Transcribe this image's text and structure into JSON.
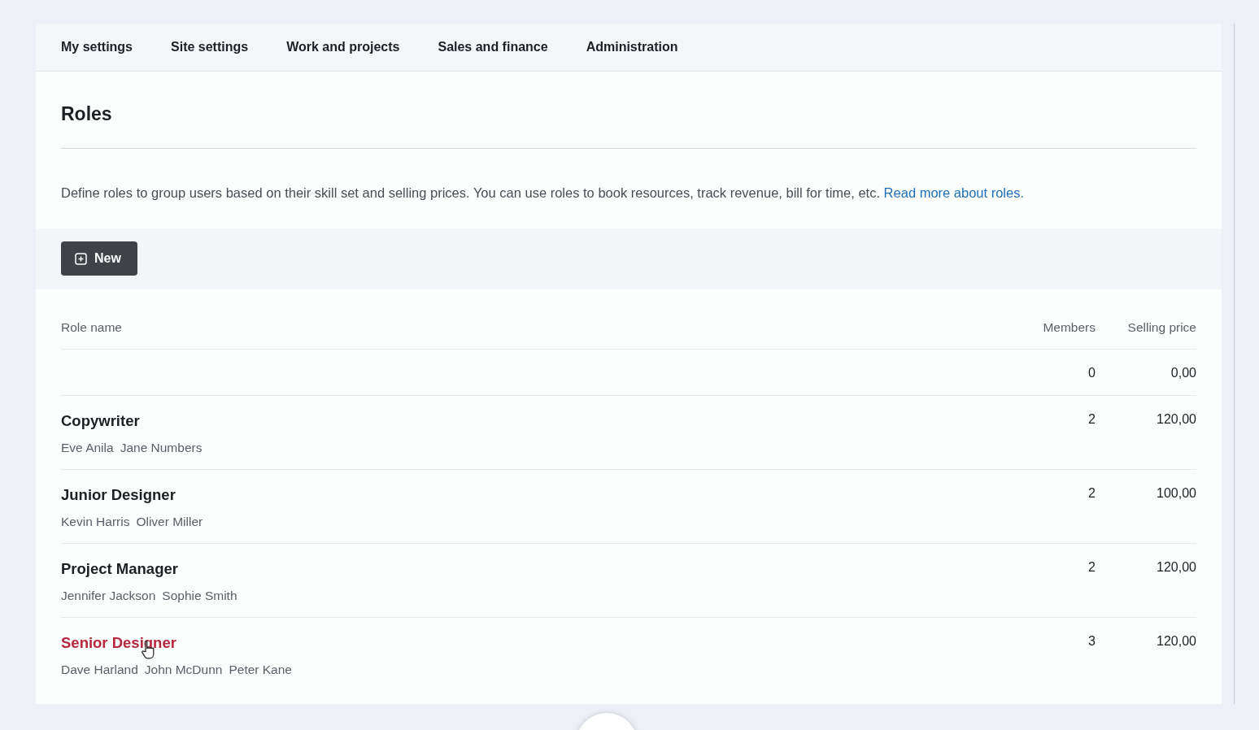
{
  "tabs": [
    {
      "label": "My settings",
      "selected": false
    },
    {
      "label": "Site settings",
      "selected": false
    },
    {
      "label": "Work and projects",
      "selected": false
    },
    {
      "label": "Sales and finance",
      "selected": false
    },
    {
      "label": "Administration",
      "selected": false
    }
  ],
  "page_title": "Roles",
  "description": {
    "text": "Define roles to group users based on their skill set and selling prices. You can use roles to book resources, track revenue, bill for time, etc.",
    "link": "Read more about roles."
  },
  "new_button": "New",
  "table": {
    "columns": [
      "Role name",
      "Members",
      "Selling price"
    ],
    "rows": [
      {
        "members_count": "0",
        "price": "0,00"
      },
      {
        "name": "Copywriter",
        "members": [
          "Eve Anila",
          "Jane Numbers"
        ],
        "members_count": "2",
        "price": "120,00",
        "highlighted": false
      },
      {
        "name": "Junior Designer",
        "members": [
          "Kevin Harris",
          "Oliver Miller"
        ],
        "members_count": "2",
        "price": "100,00",
        "highlighted": false
      },
      {
        "name": "Project Manager",
        "members": [
          "Jennifer Jackson",
          "Sophie Smith"
        ],
        "members_count": "2",
        "price": "120,00",
        "highlighted": false
      },
      {
        "name": "Senior Designer",
        "members": [
          "Dave Harland",
          "John McDunn",
          "Peter Kane"
        ],
        "members_count": "3",
        "price": "120,00",
        "highlighted": true
      }
    ]
  }
}
